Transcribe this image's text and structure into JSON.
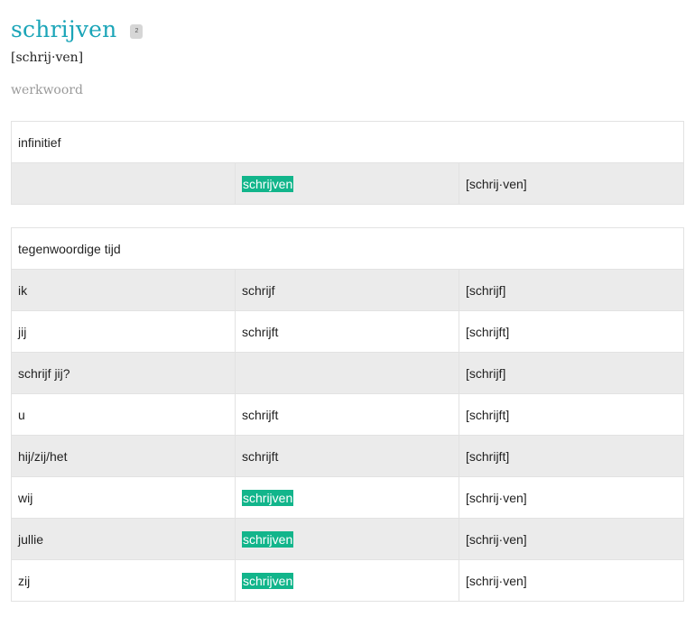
{
  "entry": {
    "word": "schrijven",
    "badge": "2",
    "syllabification": "[schrij·ven]",
    "part_of_speech": "werkwoord"
  },
  "infinitive": {
    "header": "infinitief",
    "row": {
      "subject": "",
      "form": "schrijven",
      "pron": "[schrij·ven]",
      "highlight": true
    }
  },
  "present": {
    "header": "tegenwoordige tijd",
    "rows": [
      {
        "subject": "ik",
        "form": "schrijf",
        "pron": "[schrijf]",
        "highlight": false
      },
      {
        "subject": "jij",
        "form": "schrijft",
        "pron": "[schrijft]",
        "highlight": false
      },
      {
        "subject": "schrijf jij?",
        "form": "",
        "pron": "[schrijf]",
        "highlight": false
      },
      {
        "subject": "u",
        "form": "schrijft",
        "pron": "[schrijft]",
        "highlight": false
      },
      {
        "subject": "hij/zij/het",
        "form": "schrijft",
        "pron": "[schrijft]",
        "highlight": false
      },
      {
        "subject": "wij",
        "form": "schrijven",
        "pron": "[schrij·ven]",
        "highlight": true
      },
      {
        "subject": "jullie",
        "form": "schrijven",
        "pron": "[schrij·ven]",
        "highlight": true
      },
      {
        "subject": "zij",
        "form": "schrijven",
        "pron": "[schrij·ven]",
        "highlight": true
      }
    ]
  }
}
